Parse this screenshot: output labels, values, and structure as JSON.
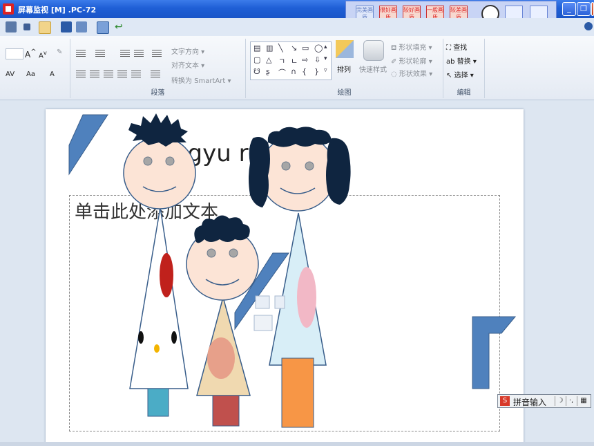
{
  "titlebar": {
    "title": "屏幕监视 [M] .PC-72"
  },
  "rating_panel": {
    "buttons": [
      {
        "label": "完美画质"
      },
      {
        "label": "很好画质"
      },
      {
        "label": "较好画质"
      },
      {
        "label": "一般画质"
      },
      {
        "label": "较差画质"
      }
    ]
  },
  "ribbon": {
    "paragraph": {
      "label": "段落",
      "text_direction": "文字方向",
      "align_text": "对齐文本",
      "convert_smartart": "转换为 SmartArt"
    },
    "drawing": {
      "label": "绘图",
      "arrange": "排列",
      "quick_styles": "快速样式",
      "shape_fill": "形状填充",
      "shape_outline": "形状轮廓",
      "shape_effects": "形状效果"
    },
    "editing": {
      "label": "编辑",
      "find": "查找",
      "replace": "替换",
      "select": "选择"
    }
  },
  "slide": {
    "title_text": "hgyu            ryu",
    "content_placeholder": "单击此处添加文本"
  },
  "ime": {
    "label": "拼音输入"
  },
  "colors": {
    "accent_blue": "#4f81bd",
    "skin": "#fce4d6",
    "hair": "#0f2540",
    "teal": "#4bacc6",
    "red": "#c0504d",
    "orange": "#f79646"
  }
}
